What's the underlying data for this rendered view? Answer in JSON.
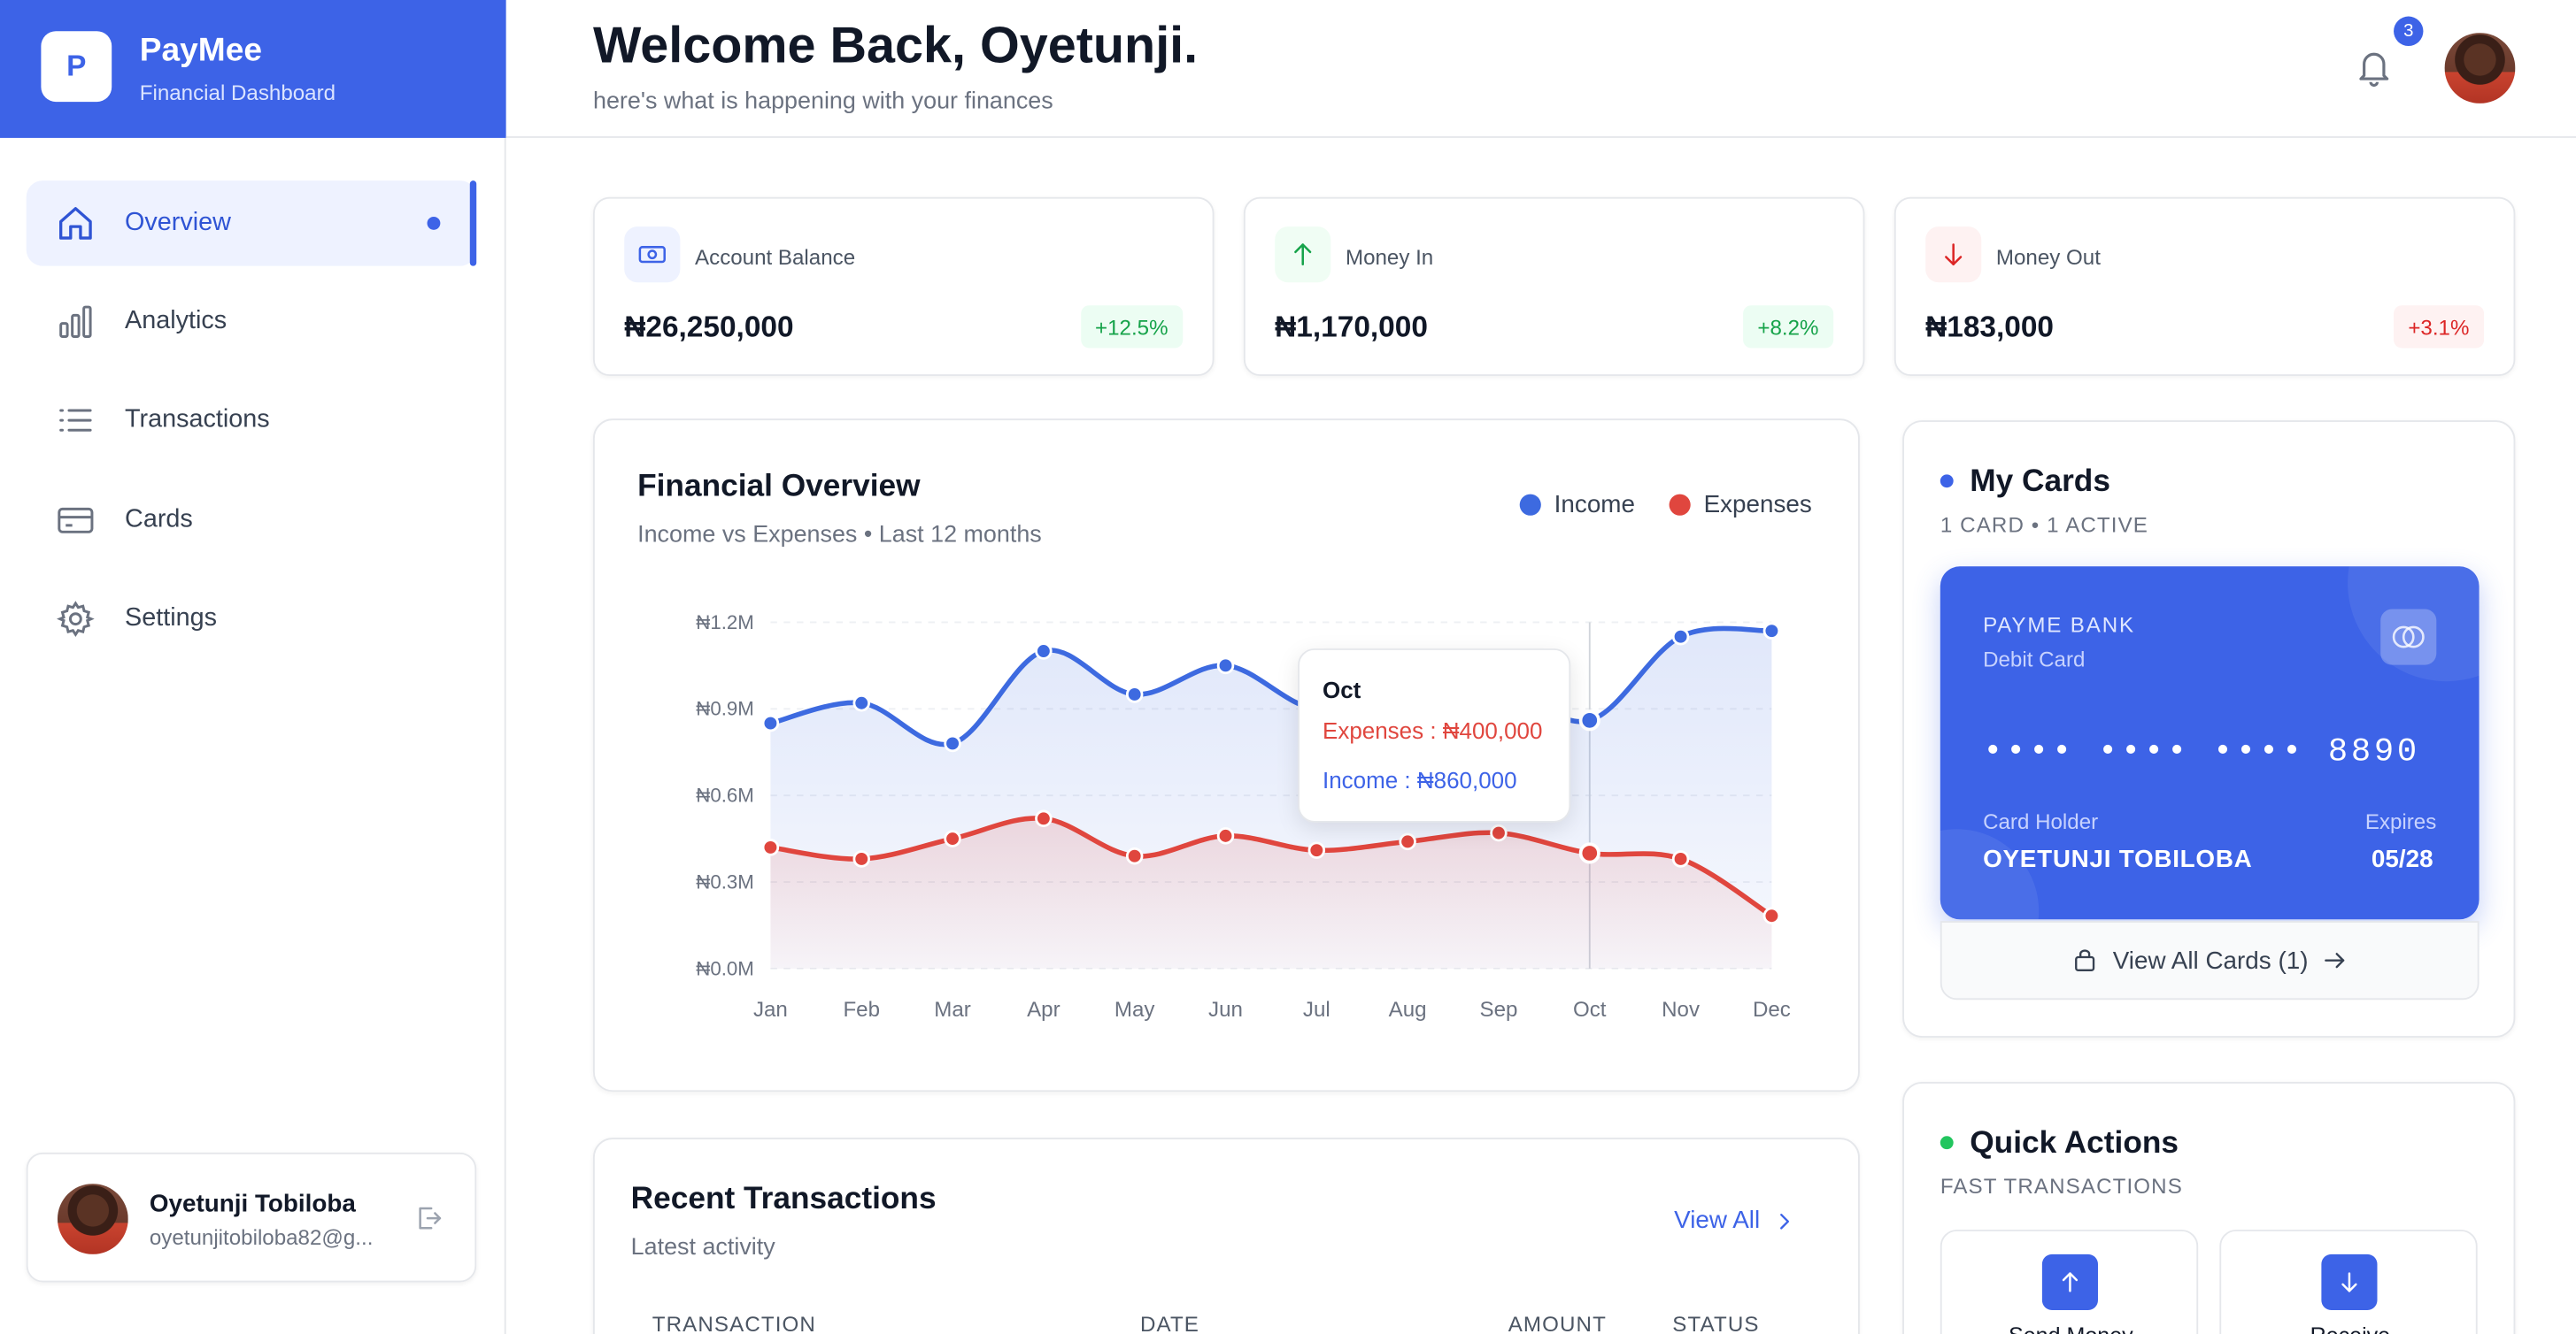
{
  "brand": {
    "logo_letter": "P",
    "name": "PayMee",
    "subtitle": "Financial Dashboard"
  },
  "nav": {
    "items": [
      {
        "label": "Overview",
        "icon": "home-icon",
        "active": true
      },
      {
        "label": "Analytics",
        "icon": "bar-chart-icon",
        "active": false
      },
      {
        "label": "Transactions",
        "icon": "list-icon",
        "active": false
      },
      {
        "label": "Cards",
        "icon": "credit-card-icon",
        "active": false
      },
      {
        "label": "Settings",
        "icon": "gear-icon",
        "active": false
      }
    ]
  },
  "user": {
    "name": "Oyetunji Tobiloba",
    "email": "oyetunjitobiloba82@g..."
  },
  "header": {
    "title": "Welcome Back, Oyetunji.",
    "subtitle": "here's what is happening with your finances",
    "notification_count": "3"
  },
  "stats": [
    {
      "label": "Account Balance",
      "value": "₦26,250,000",
      "change": "+12.5%",
      "icon": "money-icon"
    },
    {
      "label": "Money In",
      "value": "₦1,170,000",
      "change": "+8.2%",
      "icon": "arrow-up-icon"
    },
    {
      "label": "Money Out",
      "value": "₦183,000",
      "change": "+3.1%",
      "icon": "arrow-down-icon"
    }
  ],
  "overview": {
    "title": "Financial Overview",
    "subtitle": "Income vs Expenses • Last 12 months"
  },
  "chart_data": {
    "type": "line",
    "title": "Financial Overview",
    "subtitle": "Income vs Expenses • Last 12 months",
    "categories": [
      "Jan",
      "Feb",
      "Mar",
      "Apr",
      "May",
      "Jun",
      "Jul",
      "Aug",
      "Sep",
      "Oct",
      "Nov",
      "Dec"
    ],
    "y_ticks": [
      "₦1.2M",
      "₦0.9M",
      "₦0.6M",
      "₦0.3M",
      "₦0.0M"
    ],
    "ylim": [
      0,
      1200000
    ],
    "grid": true,
    "legend_position": "top-right",
    "series": [
      {
        "name": "Income",
        "color": "#3d6ae0",
        "values": [
          850000,
          920000,
          780000,
          1100000,
          950000,
          1050000,
          900000,
          1000000,
          980000,
          860000,
          1150000,
          1170000
        ]
      },
      {
        "name": "Expenses",
        "color": "#e0463e",
        "values": [
          420000,
          380000,
          450000,
          520000,
          390000,
          460000,
          410000,
          440000,
          470000,
          400000,
          380000,
          183000
        ]
      }
    ],
    "tooltip": {
      "month": "Oct",
      "expenses_text": "Expenses : ₦400,000",
      "income_text": "Income : ₦860,000"
    }
  },
  "cards": {
    "title": "My Cards",
    "caption": "1 CARD • 1 ACTIVE",
    "bank": "PAYME BANK",
    "type": "Debit Card",
    "number": "•••• •••• •••• 8890",
    "holder_label": "Card Holder",
    "holder_name": "OYETUNJI TOBILOBA",
    "expires_label": "Expires",
    "expires_value": "05/28",
    "view_all": "View All Cards (1)"
  },
  "transactions": {
    "title": "Recent Transactions",
    "subtitle": "Latest activity",
    "view_all": "View All",
    "columns": [
      "TRANSACTION",
      "DATE",
      "AMOUNT",
      "STATUS"
    ]
  },
  "quick_actions": {
    "title": "Quick Actions",
    "caption": "FAST TRANSACTIONS",
    "items": [
      {
        "label": "Send Money",
        "icon": "arrow-up-icon"
      },
      {
        "label": "Receive",
        "icon": "arrow-down-icon"
      }
    ]
  },
  "colors": {
    "primary": "#3d63e7",
    "income": "#3d6ae0",
    "expenses": "#e0463e",
    "positive": "#16a34a",
    "negative": "#dc2626"
  }
}
